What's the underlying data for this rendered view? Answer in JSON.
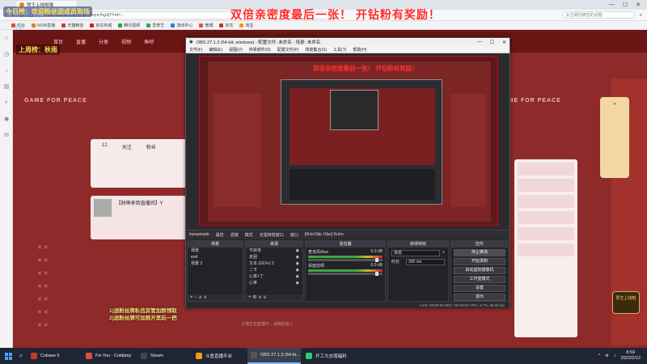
{
  "browser": {
    "tab_title": "赞王上线啦哦",
    "url": "https://www.douyu.com/topic/bgdjf?rid=...",
    "search_placeholder": "女生最怕被怼的话题",
    "bookmarks": [
      "综合",
      "NOW直播",
      "天猫精选",
      "京东商城",
      "腾讯视频",
      "爱奇艺",
      "游戏中心",
      "微博",
      "京东",
      "淘宝"
    ]
  },
  "page": {
    "nav": [
      "首页",
      "直播",
      "分类",
      "视频",
      "鱼吧"
    ],
    "banner_left": "GAME FOR PEACE",
    "banner_right": "GAME FOR PEACE",
    "stats": [
      "12",
      "关注",
      "粉丝"
    ],
    "card_title": "【财神来到直播间】Y",
    "footer": "主播正在直播中，请稍后进入"
  },
  "overlay": {
    "title": "双倍亲密度最后一张！ 开钻粉有奖励！",
    "welcome": "今日榜：欢迎粉丝团成员到场",
    "gift": "+5",
    "last_gift": "上周榜：秋雨",
    "rule1": "1)送粉丝牌私信房管加群领取",
    "rule2": "2)送粉丝牌可加群开黑玩一把",
    "logo": "赞王上线啦"
  },
  "obs": {
    "title": "OBS 27.1.3 (64-bit, windows) - 配置文件: 未命名 - 场景: 未命名",
    "menu": [
      "文件(F)",
      "编辑(E)",
      "视图(V)",
      "停靠部件(D)",
      "配置文件(P)",
      "场景集合(S)",
      "工具(T)",
      "帮助(H)"
    ],
    "preview_title": "双倍亲密度最后一张！ 开钻粉有奖励！",
    "source_bar": [
      "topepeople",
      "属性",
      "滤镜",
      "模式",
      "无需特效窗口",
      "窗口",
      "[tfctorStip 10pc] Kuhn"
    ],
    "scenes_header": "场景",
    "scenes": [
      "场景",
      "end",
      "场景 2"
    ],
    "sources_header": "来源",
    "sources": [
      "节目单",
      "走团",
      "文本 (GDI+) 2",
      "二卡",
      "心率+了",
      "心率"
    ],
    "mixer_header": "混音器",
    "mixer": [
      {
        "name": "麦克风/Aux",
        "db": "0.0 dB"
      },
      {
        "name": "桌面音频",
        "db": "0.0 dB"
      }
    ],
    "transitions_header": "转场特效",
    "transition_type": "渐变",
    "duration_label": "时长",
    "duration_value": "300 ms",
    "controls_header": "控件",
    "controls": [
      "停止推流",
      "开始录制",
      "启动虚拟摄像机",
      "工作室模式",
      "设置",
      "退出"
    ],
    "status": "LIVE: 00:00:00   REC: 00:00:00   CPU: 3.7%, 60.00 fps"
  },
  "taskbar": {
    "items": [
      "Cubase 5",
      "Fix You - Coldplay",
      "Steam",
      "斗鱼直播平台",
      "OBS 27.1.3 (64-bi...",
      "开工大吉增福利"
    ],
    "time": "8:59",
    "date": "2022/2/12"
  },
  "colors": {
    "accent": "#ff2a2a",
    "page_bg": "#8e2a2a",
    "taskbar": "#1f2533"
  }
}
